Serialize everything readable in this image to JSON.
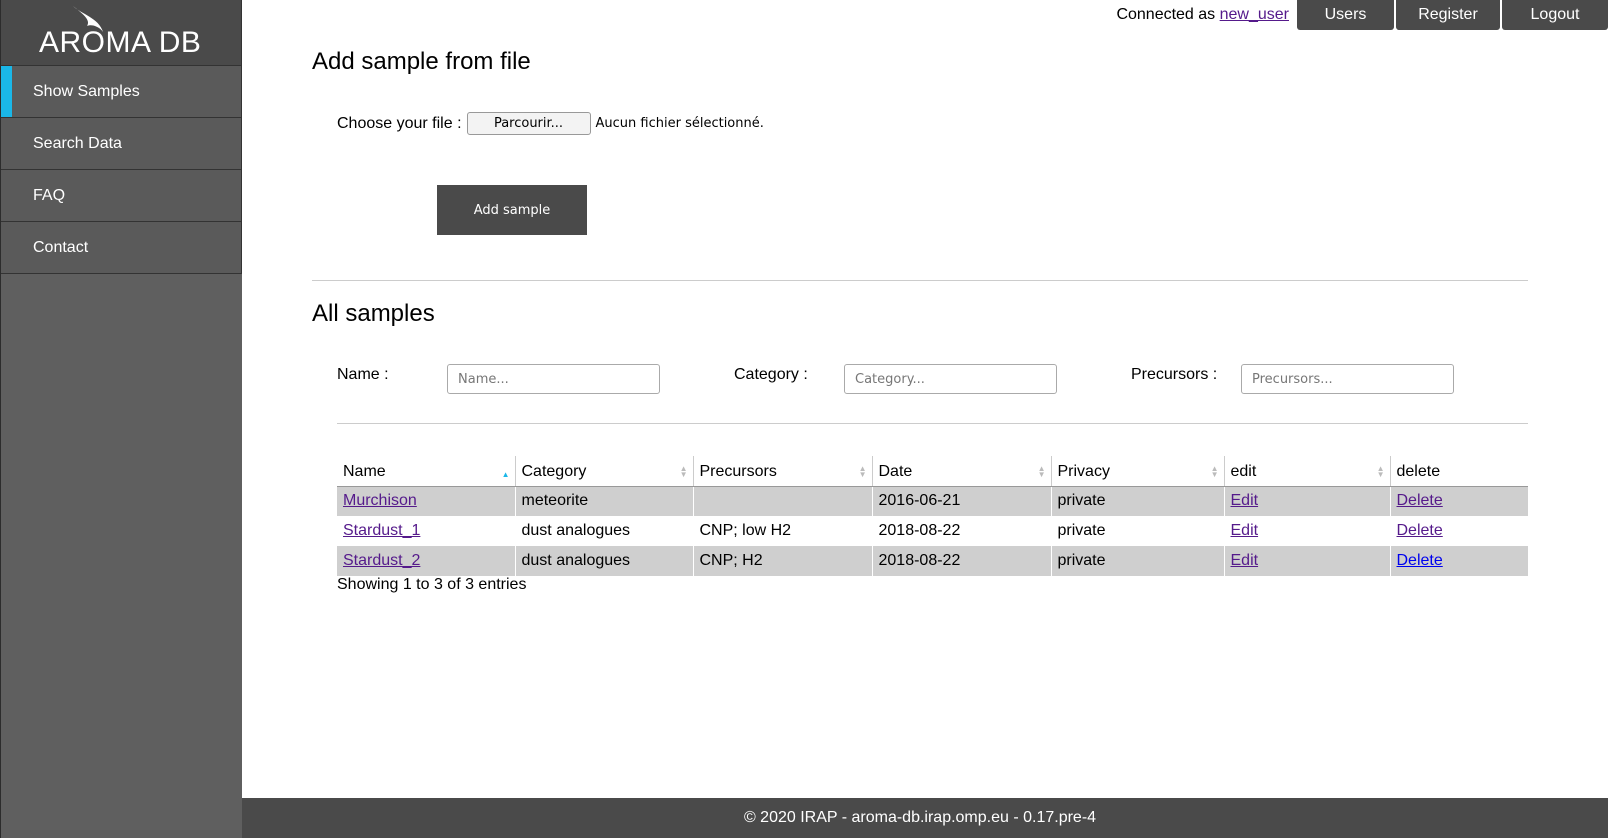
{
  "brand": {
    "logo_text": "AROMA DB"
  },
  "sidebar": {
    "items": [
      {
        "label": "Show Samples"
      },
      {
        "label": "Search Data"
      },
      {
        "label": "FAQ"
      },
      {
        "label": "Contact"
      }
    ],
    "active_accent": "#1ab7e8"
  },
  "topbar": {
    "connected_prefix": "Connected as",
    "username": "new_user",
    "buttons": [
      "Users",
      "Register",
      "Logout"
    ]
  },
  "add_section": {
    "title": "Add sample from file",
    "file_label": "Choose your file :",
    "browse_label": "Parcourir...",
    "no_file_text": "Aucun fichier sélectionné.",
    "submit_label": "Add sample"
  },
  "samples_section": {
    "title": "All samples",
    "filters": [
      {
        "label": "Name :",
        "placeholder": "Name..."
      },
      {
        "label": "Category :",
        "placeholder": "Category..."
      },
      {
        "label": "Precursors :",
        "placeholder": "Precursors..."
      }
    ],
    "columns": [
      "Name",
      "Category",
      "Precursors",
      "Date",
      "Privacy",
      "edit",
      "delete"
    ],
    "rows": [
      {
        "name": "Murchison",
        "category": "meteorite",
        "precursors": "",
        "date": "2016-06-21",
        "privacy": "private",
        "edit": "Edit",
        "delete": "Delete"
      },
      {
        "name": "Stardust_1",
        "category": "dust analogues",
        "precursors": "CNP; low H2",
        "date": "2018-08-22",
        "privacy": "private",
        "edit": "Edit",
        "delete": "Delete"
      },
      {
        "name": "Stardust_2",
        "category": "dust analogues",
        "precursors": "CNP; H2",
        "date": "2018-08-22",
        "privacy": "private",
        "edit": "Edit",
        "delete": "Delete"
      }
    ],
    "info": "Showing 1 to 3 of 3 entries"
  },
  "footer": {
    "text": "© 2020 IRAP - aroma-db.irap.omp.eu - 0.17.pre-4"
  }
}
